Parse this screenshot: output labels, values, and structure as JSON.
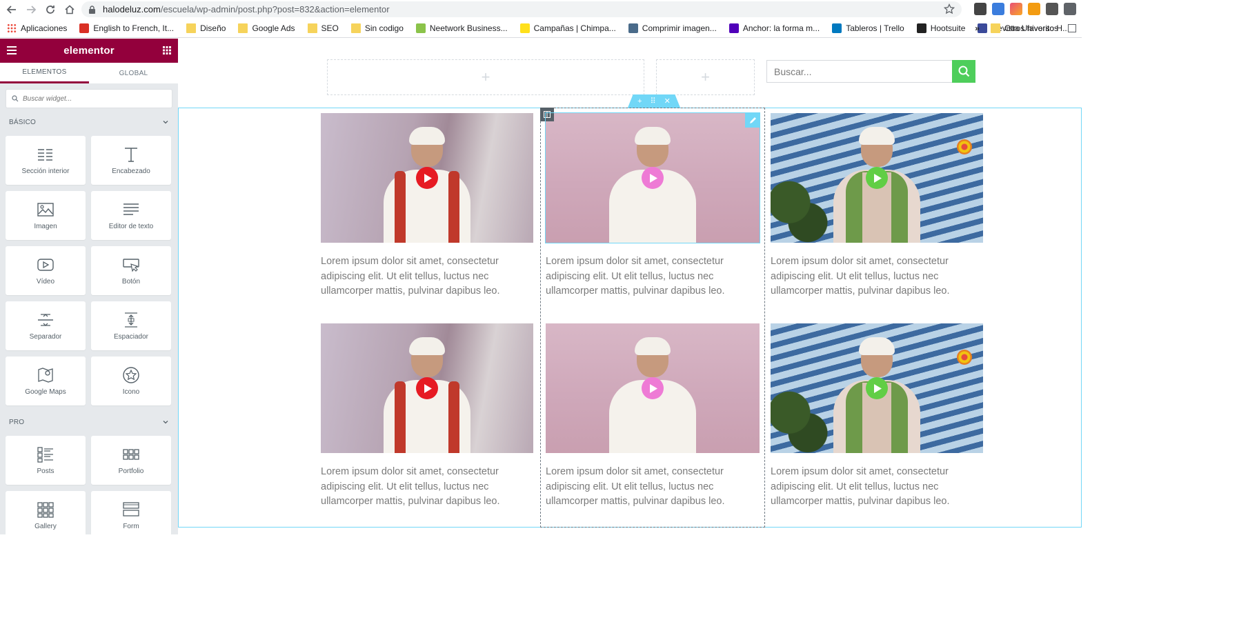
{
  "browser": {
    "url_host": "halodeluz.com",
    "url_path": "/escuela/wp-admin/post.php?post=832&action=elementor",
    "bookmarks": [
      {
        "label": "Aplicaciones",
        "icon": "apps-grid-icon",
        "color": "#4285f4"
      },
      {
        "label": "English to French, It...",
        "icon": "wr-icon",
        "color": "#d93025"
      },
      {
        "label": "Diseño",
        "icon": "folder-icon",
        "color": "#f6d35b"
      },
      {
        "label": "Google Ads",
        "icon": "folder-icon",
        "color": "#f6d35b"
      },
      {
        "label": "SEO",
        "icon": "folder-icon",
        "color": "#f6d35b"
      },
      {
        "label": "Sin codigo",
        "icon": "folder-icon",
        "color": "#f6d35b"
      },
      {
        "label": "Neetwork Business...",
        "icon": "neetwork-icon",
        "color": "#8bc34a"
      },
      {
        "label": "Campañas | Chimpa...",
        "icon": "mailchimp-icon",
        "color": "#ffe01b"
      },
      {
        "label": "Comprimir imagen...",
        "icon": "compress-icon",
        "color": "#4a6b8a"
      },
      {
        "label": "Anchor: la forma m...",
        "icon": "anchor-icon",
        "color": "#5000b9"
      },
      {
        "label": "Tableros | Trello",
        "icon": "trello-icon",
        "color": "#0079bf"
      },
      {
        "label": "Hootsuite",
        "icon": "hootsuite-icon",
        "color": "#222222"
      },
      {
        "label": "Revista Universo H...",
        "icon": "revista-icon",
        "color": "#3b4a9a"
      }
    ],
    "more_label": "»",
    "other_bookmarks": "Otros favoritos"
  },
  "panel": {
    "brand": "elementor",
    "tabs": [
      "ELEMENTOS",
      "GLOBAL"
    ],
    "search_placeholder": "Buscar widget...",
    "categories": [
      {
        "label": "BÁSICO",
        "widgets": [
          {
            "label": "Sección interior",
            "icon": "inner-section-icon"
          },
          {
            "label": "Encabezado",
            "icon": "heading-icon"
          },
          {
            "label": "Imagen",
            "icon": "image-icon"
          },
          {
            "label": "Editor de texto",
            "icon": "text-editor-icon"
          },
          {
            "label": "Vídeo",
            "icon": "video-icon"
          },
          {
            "label": "Botón",
            "icon": "button-icon"
          },
          {
            "label": "Separador",
            "icon": "divider-icon"
          },
          {
            "label": "Espaciador",
            "icon": "spacer-icon"
          },
          {
            "label": "Google Maps",
            "icon": "google-maps-icon"
          },
          {
            "label": "Icono",
            "icon": "star-icon"
          }
        ]
      },
      {
        "label": "PRO",
        "widgets": [
          {
            "label": "Posts",
            "icon": "posts-icon"
          },
          {
            "label": "Portfolio",
            "icon": "portfolio-icon"
          },
          {
            "label": "Gallery",
            "icon": "gallery-icon"
          },
          {
            "label": "Form",
            "icon": "form-icon"
          }
        ]
      }
    ]
  },
  "preview": {
    "search_placeholder": "Buscar...",
    "add_symbol": "+",
    "caption": "Lorem ipsum dolor sit amet, consectetur adipiscing elit. Ut elit tellus, luctus nec ullamcorper mattis, pulvinar dapibus leo.",
    "videos": [
      {
        "play_color": "#e61b23",
        "variant": "red-scarf"
      },
      {
        "play_color": "#ee7bd5",
        "variant": "pink-meditation"
      },
      {
        "play_color": "#61ce45",
        "variant": "green-vest"
      },
      {
        "play_color": "#e61b23",
        "variant": "red-scarf"
      },
      {
        "play_color": "#ee7bd5",
        "variant": "pink-meditation"
      },
      {
        "play_color": "#61ce45",
        "variant": "green-vest"
      }
    ]
  },
  "colors": {
    "brand": "#93003c",
    "selection": "#71d7f7",
    "search_button": "#4ece5b"
  }
}
